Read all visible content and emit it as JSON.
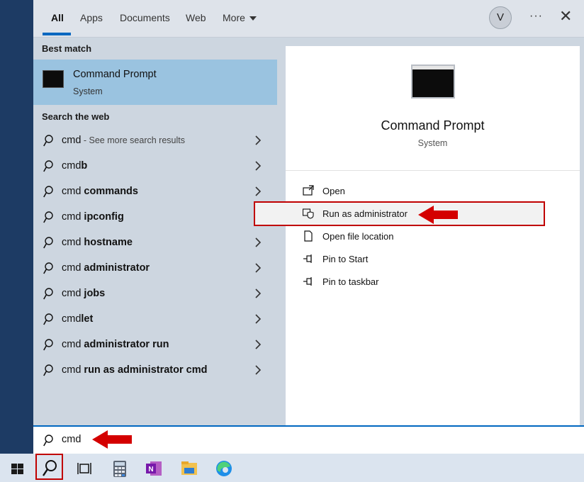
{
  "tabs": [
    {
      "label": "All",
      "active": true
    },
    {
      "label": "Apps"
    },
    {
      "label": "Documents"
    },
    {
      "label": "Web"
    },
    {
      "label": "More"
    }
  ],
  "header": {
    "avatar_letter": "V",
    "more_options": "···",
    "close": "✕"
  },
  "best_match": {
    "heading": "Best match",
    "title": "Command Prompt",
    "subtitle": "System"
  },
  "web": {
    "heading": "Search the web",
    "items": [
      {
        "prefix": "cmd",
        "bold": "",
        "suffix": " - See more search results"
      },
      {
        "prefix": "cmd",
        "bold": "b",
        "suffix": ""
      },
      {
        "prefix": "cmd ",
        "bold": "commands",
        "suffix": ""
      },
      {
        "prefix": "cmd ",
        "bold": "ipconfig",
        "suffix": ""
      },
      {
        "prefix": "cmd ",
        "bold": "hostname",
        "suffix": ""
      },
      {
        "prefix": "cmd ",
        "bold": "administrator",
        "suffix": ""
      },
      {
        "prefix": "cmd ",
        "bold": "jobs",
        "suffix": ""
      },
      {
        "prefix": "cmd",
        "bold": "let",
        "suffix": ""
      },
      {
        "prefix": "cmd ",
        "bold": "administrator run",
        "suffix": ""
      },
      {
        "prefix": "cmd ",
        "bold": "run as administrator cmd",
        "suffix": ""
      }
    ]
  },
  "preview": {
    "title": "Command Prompt",
    "subtitle": "System",
    "actions": [
      {
        "label": "Open",
        "icon": "open-icon"
      },
      {
        "label": "Run as administrator",
        "icon": "shield-icon"
      },
      {
        "label": "Open file location",
        "icon": "file-location-icon"
      },
      {
        "label": "Pin to Start",
        "icon": "pin-icon"
      },
      {
        "label": "Pin to taskbar",
        "icon": "pin-icon"
      }
    ]
  },
  "search": {
    "value": "cmd"
  },
  "taskbar": {
    "items": [
      "windows-start-icon",
      "search-icon",
      "task-view-icon",
      "calculator-icon",
      "onenote-icon",
      "file-explorer-icon",
      "edge-icon"
    ]
  },
  "colors": {
    "accent": "#0067c0",
    "highlight": "#9ac3e0",
    "annotation_red": "#c00000"
  }
}
